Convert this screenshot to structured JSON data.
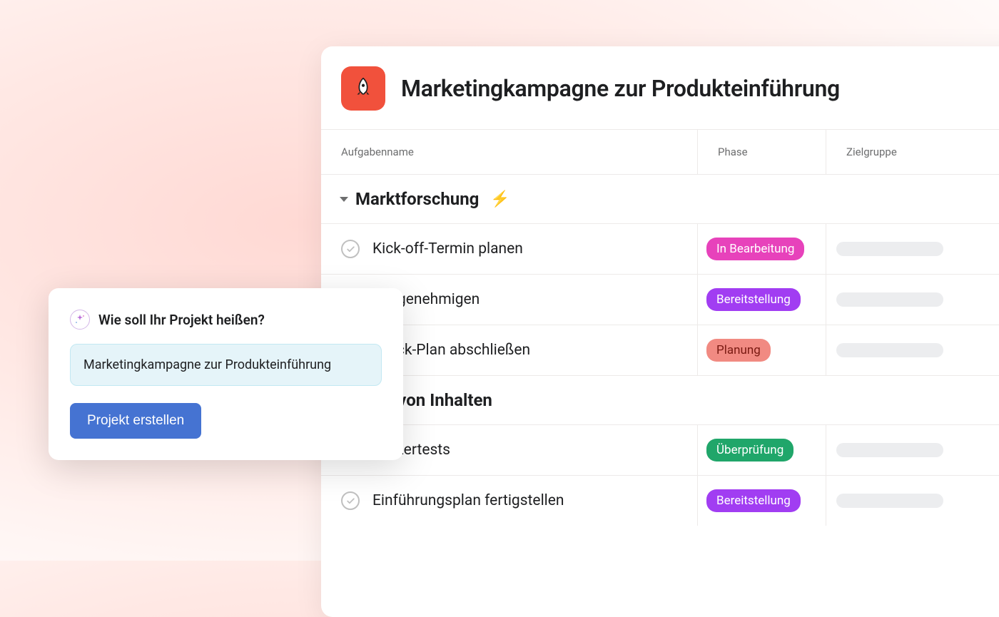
{
  "project": {
    "title": "Marketingkampagne zur Produkteinführung",
    "icon": "rocket-icon"
  },
  "columns": {
    "task": "Aufgabenname",
    "phase": "Phase",
    "target": "Zielgruppe"
  },
  "sections": [
    {
      "title": "Marktforschung",
      "emoji": "⚡",
      "tasks": [
        {
          "name": "Kick-off-Termin planen",
          "phase": "In Bearbeitung",
          "phase_color": "pink"
        },
        {
          "name": "get genehmigen",
          "phase": "Bereitstellung",
          "phase_color": "purple"
        },
        {
          "name": "kback-Plan abschließen",
          "phase": "Planung",
          "phase_color": "salmon"
        }
      ]
    },
    {
      "title": "llung von Inhalten",
      "emoji": "",
      "tasks": [
        {
          "name": "Nutzertests",
          "phase": "Überprüfung",
          "phase_color": "green"
        },
        {
          "name": "Einführungsplan fertigstellen",
          "phase": "Bereitstellung",
          "phase_color": "purple"
        }
      ]
    }
  ],
  "dialog": {
    "heading": "Wie soll Ihr Projekt heißen?",
    "input_value": "Marketingkampagne zur Produkteinführung",
    "create_label": "Projekt erstellen"
  }
}
